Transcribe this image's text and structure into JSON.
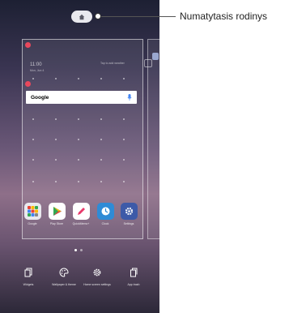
{
  "callout": {
    "label": "Numatytasis rodinys"
  },
  "widgets": {
    "clock_time": "11:00",
    "clock_date": "Mon, Jun 4",
    "weather_text": "Tap to add weather",
    "search_logo": "Google"
  },
  "apps": [
    {
      "label": "Google",
      "icon": "google-folder-icon"
    },
    {
      "label": "Play Store",
      "icon": "play-store-icon"
    },
    {
      "label": "QuickMemo+",
      "icon": "quickmemo-icon"
    },
    {
      "label": "Clock",
      "icon": "clock-icon"
    },
    {
      "label": "Settings",
      "icon": "settings-icon"
    }
  ],
  "toolbar": [
    {
      "label": "Widgets",
      "icon": "widgets-icon"
    },
    {
      "label": "Wallpaper & theme",
      "icon": "palette-icon"
    },
    {
      "label": "Home screen settings",
      "icon": "gear-icon"
    },
    {
      "label": "App trash",
      "icon": "trash-icon"
    }
  ],
  "pages": {
    "count": 2,
    "current": 1
  }
}
